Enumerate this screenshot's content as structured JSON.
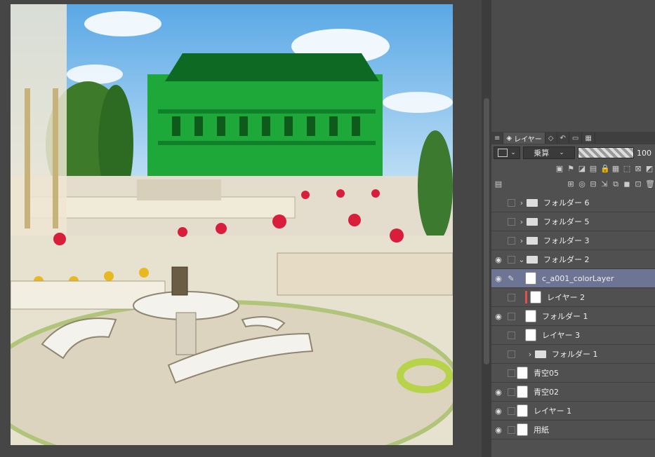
{
  "tabs": [
    {
      "label": ""
    },
    {
      "label": "レイヤー"
    },
    {
      "label": ""
    },
    {
      "label": ""
    },
    {
      "label": ""
    },
    {
      "label": ""
    }
  ],
  "blend": {
    "mode": "乗算",
    "opacity": "100"
  },
  "layers": [
    {
      "name": "フォルダー 6",
      "type": "folder",
      "visible": false,
      "depth": 0,
      "expanded": false
    },
    {
      "name": "フォルダー 5",
      "type": "folder",
      "visible": false,
      "depth": 0,
      "expanded": false
    },
    {
      "name": "フォルダー 3",
      "type": "folder",
      "visible": false,
      "depth": 0,
      "expanded": false
    },
    {
      "name": "フォルダー 2",
      "type": "folder",
      "visible": true,
      "depth": 0,
      "expanded": true
    },
    {
      "name": "c_a001_colorLayer",
      "type": "layer",
      "visible": true,
      "depth": 1,
      "selected": true
    },
    {
      "name": "レイヤー 2",
      "type": "layer",
      "visible": false,
      "depth": 1,
      "marked": true
    },
    {
      "name": "フォルダー 1",
      "type": "layer",
      "visible": true,
      "depth": 1
    },
    {
      "name": "レイヤー 3",
      "type": "layer",
      "visible": false,
      "depth": 1
    },
    {
      "name": "フォルダー 1",
      "type": "folder",
      "visible": false,
      "depth": 1,
      "expanded": false
    },
    {
      "name": "青空05",
      "type": "layer",
      "visible": false,
      "depth": 0
    },
    {
      "name": "青空02",
      "type": "layer",
      "visible": true,
      "depth": 0
    },
    {
      "name": "レイヤー 1",
      "type": "layer",
      "visible": true,
      "depth": 0
    },
    {
      "name": "用紙",
      "type": "layer",
      "visible": true,
      "depth": 0
    }
  ]
}
